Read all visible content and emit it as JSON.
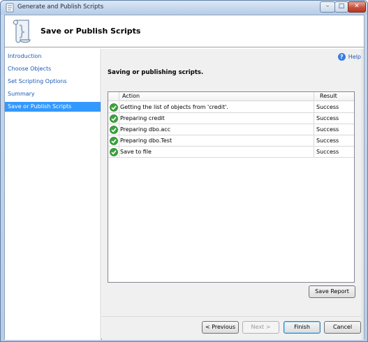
{
  "window": {
    "title": "Generate and Publish Scripts",
    "controls": {
      "minimize": "–",
      "maximize": "□",
      "close": "✕"
    }
  },
  "header": {
    "title": "Save or Publish Scripts",
    "icon": "scroll-icon"
  },
  "nav": {
    "items": [
      {
        "label": "Introduction",
        "active": false
      },
      {
        "label": "Choose Objects",
        "active": false
      },
      {
        "label": "Set Scripting Options",
        "active": false
      },
      {
        "label": "Summary",
        "active": false
      },
      {
        "label": "Save or Publish Scripts",
        "active": true
      }
    ]
  },
  "help": {
    "label": "Help",
    "icon": "help-icon"
  },
  "section_title": "Saving or publishing scripts.",
  "grid": {
    "columns": [
      "Action",
      "Result"
    ],
    "rows": [
      {
        "action": "Getting the list of objects from 'credit'.",
        "result": "Success",
        "icon": "success-check-icon"
      },
      {
        "action": "Preparing credit",
        "result": "Success",
        "icon": "success-check-icon"
      },
      {
        "action": "Preparing dbo.acc",
        "result": "Success",
        "icon": "success-check-icon"
      },
      {
        "action": "Preparing dbo.Test",
        "result": "Success",
        "icon": "success-check-icon"
      },
      {
        "action": "Save to file",
        "result": "Success",
        "icon": "success-check-icon"
      }
    ]
  },
  "buttons": {
    "save_report": "Save Report",
    "previous": "< Previous",
    "next": "Next >",
    "finish": "Finish",
    "cancel": "Cancel"
  },
  "colors": {
    "accent": "#3399ff",
    "link": "#1c5ab4",
    "success": "#3aa43a"
  }
}
